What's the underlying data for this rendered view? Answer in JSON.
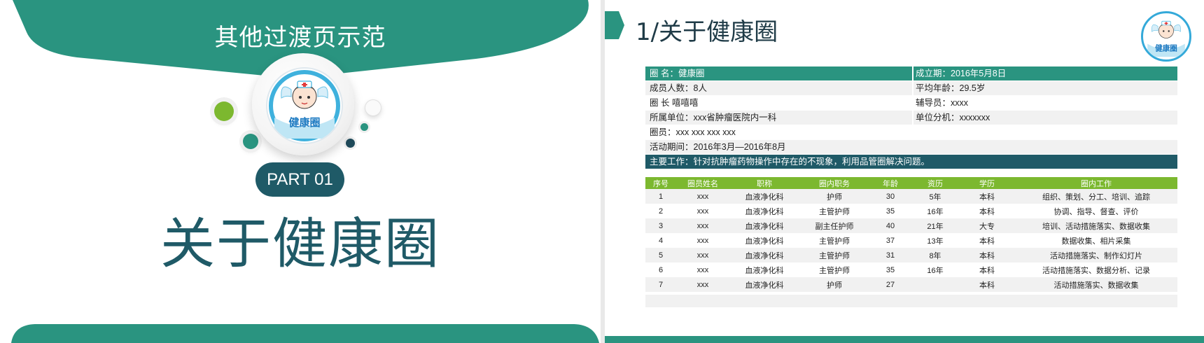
{
  "left_slide": {
    "title": "其他过渡页示范",
    "part_label": "PART 01",
    "heading": "关于健康圈",
    "logo_text": "健康圈",
    "colors": {
      "teal": "#2a9480",
      "dark_teal": "#1f5a67",
      "green_dot": "#7cb82f"
    }
  },
  "right_slide": {
    "title": "1/关于健康圈",
    "logo_text": "健康圈",
    "info_rows": [
      {
        "left": "圈  名：健康圈",
        "right": "成立期：2016年5月8日",
        "style": "green"
      },
      {
        "left": "成员人数：8人",
        "right": "平均年龄：29.5岁",
        "style": "grey"
      },
      {
        "left": "圈  长  嘻嘻嘻",
        "right": "辅导员：xxxx",
        "style": "white"
      },
      {
        "left": "所属单位：xxx省肿瘤医院内一科",
        "right": "单位分机：xxxxxxx",
        "style": "grey"
      },
      {
        "left": "圈员：xxx xxx xxx xxx",
        "right": "",
        "style": "white"
      },
      {
        "left": "活动期间：2016年3月—2016年8月",
        "right": "",
        "style": "grey"
      },
      {
        "left": "主要工作：针对抗肿瘤药物操作中存在的不现象，利用品管圈解决问题。",
        "right": "",
        "style": "dark"
      }
    ],
    "table": {
      "headers": [
        "序号",
        "圈员姓名",
        "职称",
        "圈内职务",
        "年龄",
        "资历",
        "学历",
        "圈内工作"
      ],
      "rows": [
        [
          "1",
          "xxx",
          "血液净化科",
          "护师",
          "30",
          "5年",
          "本科",
          "组织、策划、分工、培训、追踪"
        ],
        [
          "2",
          "xxx",
          "血液净化科",
          "主管护师",
          "35",
          "16年",
          "本科",
          "协调、指导、督查、评价"
        ],
        [
          "3",
          "xxx",
          "血液净化科",
          "副主任护师",
          "40",
          "21年",
          "大专",
          "培训、活动措施落实、数据收集"
        ],
        [
          "4",
          "xxx",
          "血液净化科",
          "主管护师",
          "37",
          "13年",
          "本科",
          "数据收集、相片采集"
        ],
        [
          "5",
          "xxx",
          "血液净化科",
          "主管护师",
          "31",
          "8年",
          "本科",
          "活动措施落实、制作幻灯片"
        ],
        [
          "6",
          "xxx",
          "血液净化科",
          "主管护师",
          "35",
          "16年",
          "本科",
          "活动措施落实、数据分析、记录"
        ],
        [
          "7",
          "xxx",
          "血液净化科",
          "护师",
          "27",
          "",
          "本科",
          "活动措施落实、数据收集"
        ]
      ]
    }
  }
}
